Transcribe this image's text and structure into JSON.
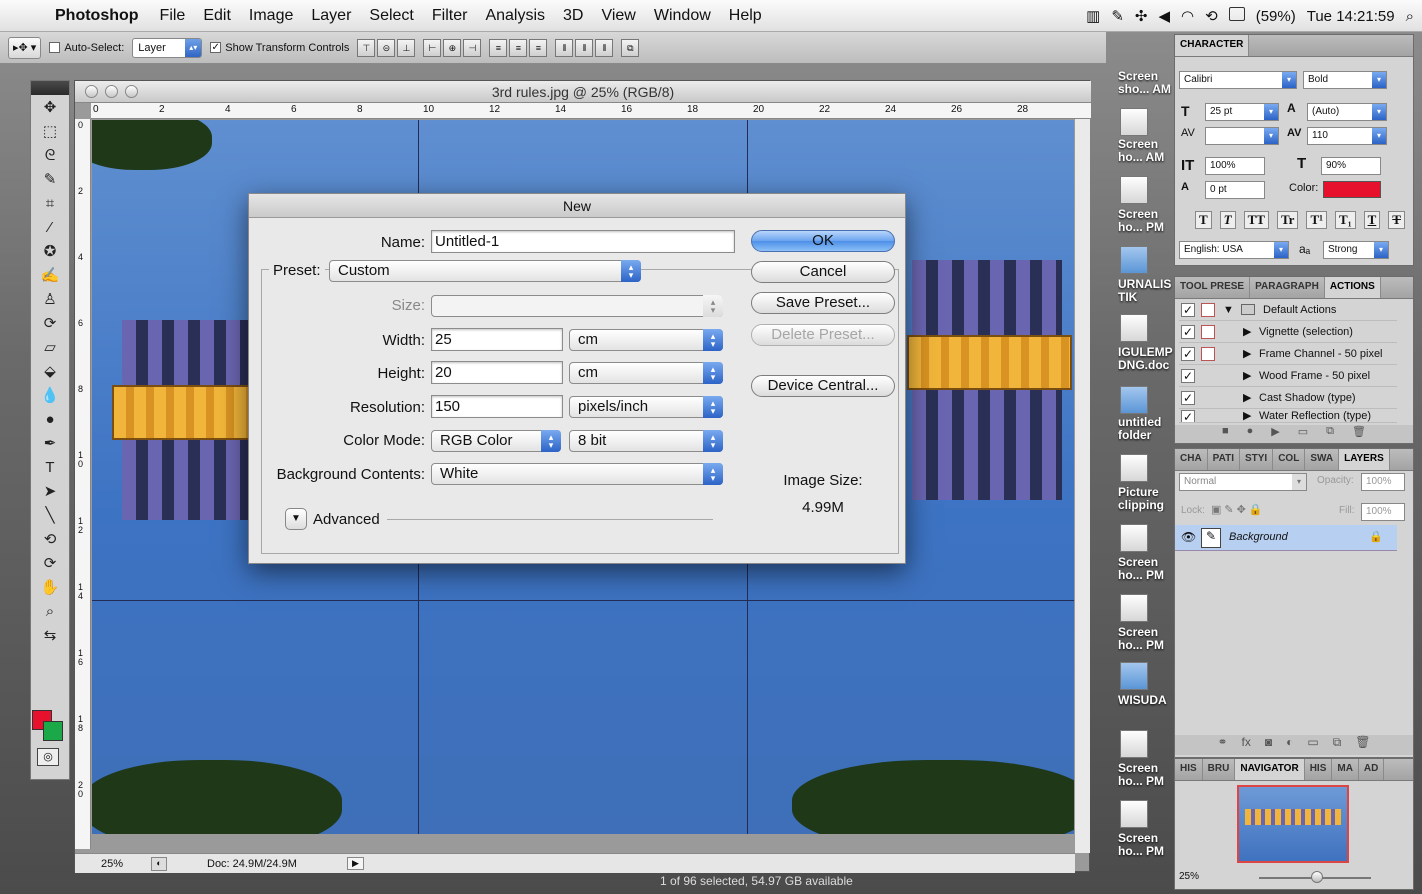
{
  "menubar": {
    "app": "Photoshop",
    "items": [
      "File",
      "Edit",
      "Image",
      "Layer",
      "Select",
      "Filter",
      "Analysis",
      "3D",
      "View",
      "Window",
      "Help"
    ],
    "battery": "(59%)",
    "clock": "Tue 14:21:59"
  },
  "options": {
    "auto_select": "Auto-Select:",
    "auto_select_target": "Layer",
    "show_transform": "Show Transform Controls"
  },
  "document": {
    "title": "3rd rules.jpg @ 25% (RGB/8)",
    "ruler_top": [
      "0",
      "2",
      "4",
      "6",
      "8",
      "10",
      "12",
      "14",
      "16",
      "18",
      "20",
      "22",
      "24",
      "26",
      "28"
    ],
    "ruler_left": [
      "0",
      "2",
      "4",
      "6",
      "8",
      "10",
      "12",
      "14",
      "16",
      "18",
      "20"
    ],
    "zoom": "25%",
    "doc_size": "Doc: 24.9M/24.9M"
  },
  "finder_status": "1 of 96 selected, 54.97 GB available",
  "dialog": {
    "title": "New",
    "name_label": "Name:",
    "name_value": "Untitled-1",
    "preset_label": "Preset:",
    "preset_value": "Custom",
    "size_label": "Size:",
    "size_value": "",
    "width_label": "Width:",
    "width_value": "25",
    "width_unit": "cm",
    "height_label": "Height:",
    "height_value": "20",
    "height_unit": "cm",
    "resolution_label": "Resolution:",
    "resolution_value": "150",
    "resolution_unit": "pixels/inch",
    "color_mode_label": "Color Mode:",
    "color_mode_value": "RGB Color",
    "bit_depth": "8 bit",
    "bg_label": "Background Contents:",
    "bg_value": "White",
    "advanced": "Advanced",
    "image_size_label": "Image Size:",
    "image_size_value": "4.99M",
    "buttons": {
      "ok": "OK",
      "cancel": "Cancel",
      "save_preset": "Save Preset...",
      "delete_preset": "Delete Preset...",
      "device_central": "Device Central..."
    }
  },
  "desktop_icons": [
    {
      "label1": "Screen",
      "label2": "sho... AM"
    },
    {
      "label1": "Screen",
      "label2": "ho... AM"
    },
    {
      "label1": "Screen",
      "label2": "ho... PM"
    },
    {
      "label1": "URNALIS",
      "label2": "TIK"
    },
    {
      "label1": "IGULEMP",
      "label2": "DNG.doc"
    },
    {
      "label1": "untitled",
      "label2": "folder"
    },
    {
      "label1": "Picture",
      "label2": "clipping"
    },
    {
      "label1": "Screen",
      "label2": "ho... PM"
    },
    {
      "label1": "Screen",
      "label2": "ho... PM"
    },
    {
      "label1": "WISUDA",
      "label2": ""
    },
    {
      "label1": "Screen",
      "label2": "ho... PM"
    },
    {
      "label1": "Screen",
      "label2": "ho... PM"
    }
  ],
  "character": {
    "tab": "CHARACTER",
    "font": "Calibri",
    "style": "Bold",
    "size": "25 pt",
    "leading": "(Auto)",
    "tracking": "110",
    "vscale": "100%",
    "hscale": "90%",
    "baseline": "0 pt",
    "color_label": "Color:",
    "language": "English: USA",
    "aa_label": "aₐ",
    "antialias": "Strong",
    "style_buttons": [
      "T",
      "T",
      "TT",
      "Tr",
      "T¹",
      "T₁",
      "T",
      "T"
    ]
  },
  "actions": {
    "tabs": [
      "TOOL PRESE",
      "PARAGRAPH",
      "ACTIONS"
    ],
    "set": "Default Actions",
    "items": [
      "Vignette (selection)",
      "Frame Channel - 50 pixel",
      "Wood Frame - 50 pixel",
      "Cast Shadow (type)",
      "Water Reflection (type)"
    ]
  },
  "layers": {
    "tabs": [
      "CHA",
      "PATI",
      "STYI",
      "COL",
      "SWA",
      "LAYERS"
    ],
    "blend": "Normal",
    "opacity_label": "Opacity:",
    "opacity": "100%",
    "lock_label": "Lock:",
    "fill_label": "Fill:",
    "fill": "100%",
    "layer_name": "Background"
  },
  "navigator": {
    "tabs": [
      "HIS",
      "BRU",
      "NAVIGATOR",
      "HIS",
      "MA",
      "AD"
    ],
    "zoom": "25%"
  },
  "colors": {
    "foreground": "#e8112d",
    "background": "#1aa848",
    "accent": "#3d73c3"
  }
}
